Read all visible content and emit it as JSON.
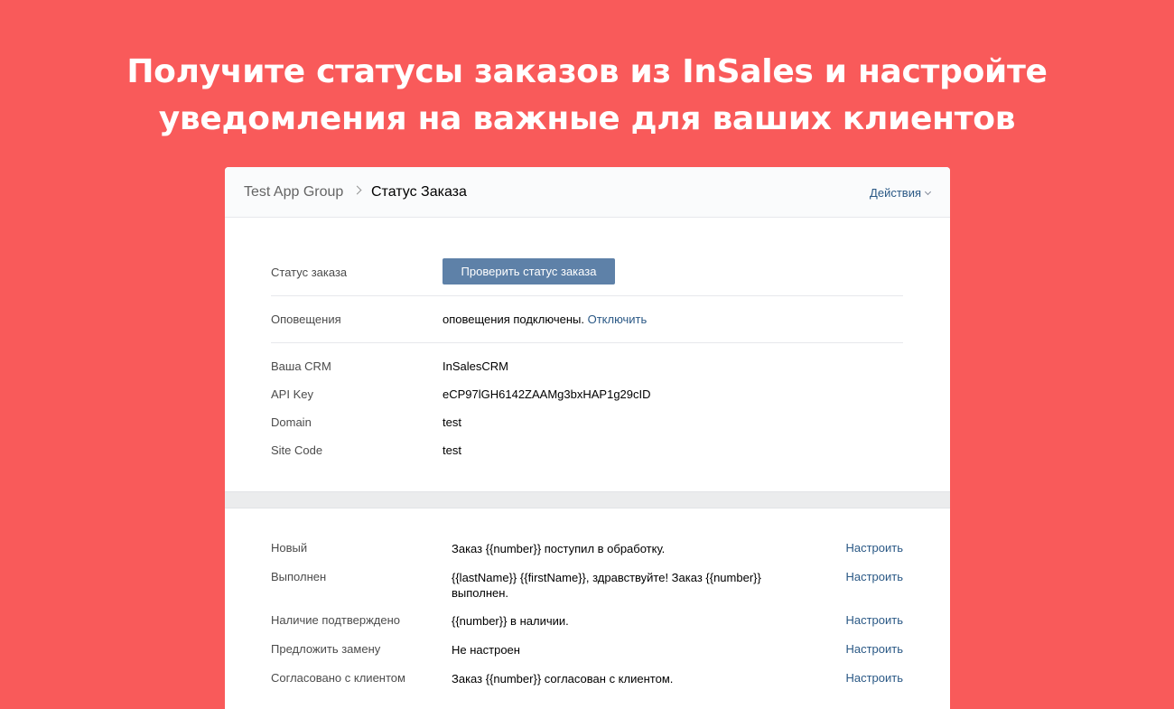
{
  "headline": {
    "line1": "Получите статусы заказов из InSales и настройте",
    "line2": "уведомления на важные для ваших клиентов"
  },
  "header": {
    "breadcrumb_root": "Test App Group",
    "breadcrumb_current": "Статус Заказа",
    "actions_label": "Действия"
  },
  "order_status": {
    "label": "Статус заказа",
    "button_label": "Проверить статус заказа"
  },
  "notifications": {
    "label": "Оповещения",
    "value": "оповещения подключены.",
    "disable_link": "Отключить"
  },
  "crm": {
    "fields": [
      {
        "label": "Ваша CRM",
        "value": "InSalesCRM"
      },
      {
        "label": "API Key",
        "value": "eCP97lGH6142ZAAMg3bxHAP1g29cID"
      },
      {
        "label": "Domain",
        "value": "test"
      },
      {
        "label": "Site Code",
        "value": "test"
      }
    ]
  },
  "statuses": [
    {
      "name": "Новый",
      "message": "Заказ {{number}} поступил в обработку.",
      "action": "Настроить"
    },
    {
      "name": "Выполнен",
      "message": "{{lastName}} {{firstName}}, здравствуйте! Заказ {{number}} выполнен.",
      "action": "Настроить"
    },
    {
      "name": "Наличие подтверждено",
      "message": "{{number}} в наличии.",
      "action": "Настроить"
    },
    {
      "name": "Предложить замену",
      "message": "Не настроен",
      "action": "Настроить"
    },
    {
      "name": "Согласовано с клиентом",
      "message": "Заказ {{number}} согласован с клиентом.",
      "action": "Настроить"
    }
  ],
  "colors": {
    "background": "#f95a5a",
    "accent_button": "#5e81a8",
    "link": "#2a5885"
  }
}
